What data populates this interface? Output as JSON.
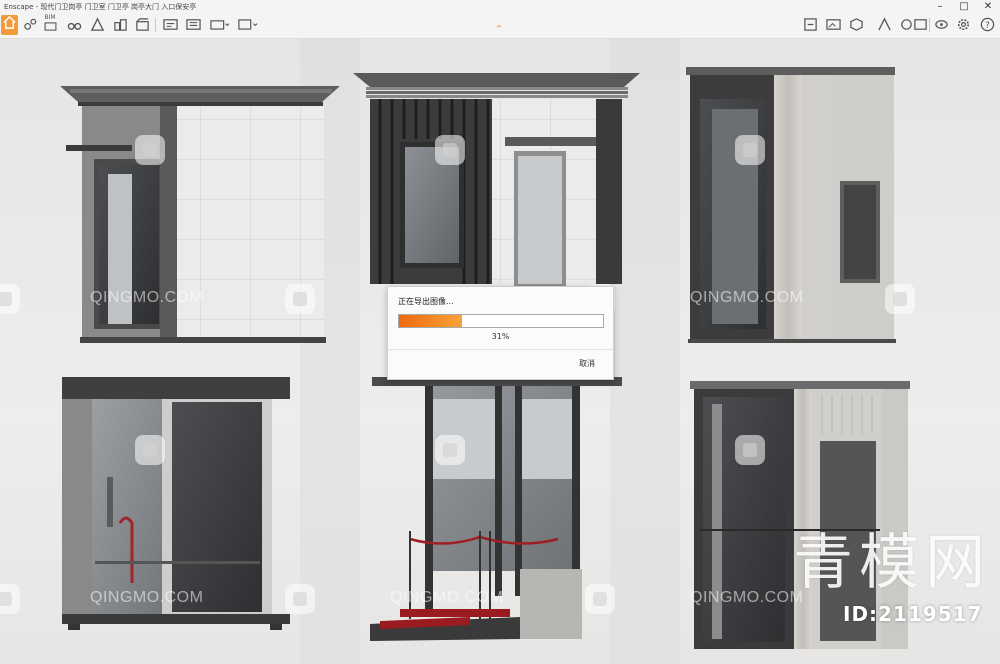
{
  "window": {
    "title": "Enscape - 现代门卫岗亭 门卫室 门卫亭 岗亭大门 入口保安亭",
    "minimize": "–",
    "maximize": "□",
    "close": "✕"
  },
  "toolbar": {
    "left_icons": [
      "home-icon",
      "views-icon",
      "bim-icon",
      "binoculars-icon",
      "collaboration-icon",
      "buildings-icon",
      "video-icon",
      "screenshot-icon",
      "batch-render-icon",
      "panorama-icon",
      "export-icon"
    ],
    "right_icons": [
      "sync-icon",
      "visual-settings-icon",
      "asset-library-icon",
      "materials-icon",
      "render-mode-icon",
      "capture-icon",
      "feedback-icon",
      "settings-icon",
      "help-icon"
    ],
    "bim_label": "BIM",
    "collapse_glyph": "⌃"
  },
  "viewport": {
    "watermark_text": "QINGMO.COM",
    "logo_text": "青模网",
    "id_text": "ID:2119517"
  },
  "export_dialog": {
    "title": "正在导出图像...",
    "progress": 0.31,
    "progress_text": "31%",
    "cancel_label": "取消",
    "progress_color": "#f07a1e"
  },
  "colors": {
    "accent": "#f29a3c",
    "titlebar": "#f4f4f4",
    "background": "#e9e8e6"
  }
}
